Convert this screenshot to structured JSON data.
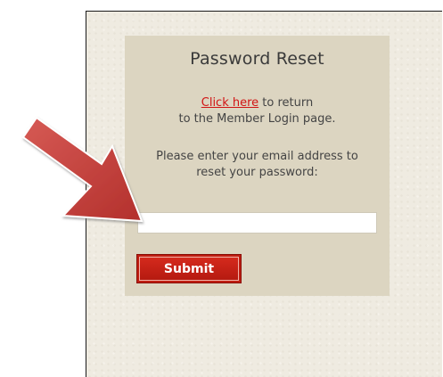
{
  "panel": {
    "title": "Password Reset",
    "return_link_text": "Click here",
    "return_text_after_link": " to return",
    "return_text_line2": "to the Member Login page.",
    "instruction_line1": "Please enter your email address to",
    "instruction_line2": "reset your password:",
    "email_value": "",
    "submit_label": "Submit"
  },
  "colors": {
    "page_background": "#efebe1",
    "panel_background": "#dcd5c1",
    "link": "#d11414",
    "button": "#bf1e12",
    "arrow": "#c53a36"
  },
  "icons": {
    "callout_arrow": "arrow-pointing-to-email-field-icon"
  }
}
